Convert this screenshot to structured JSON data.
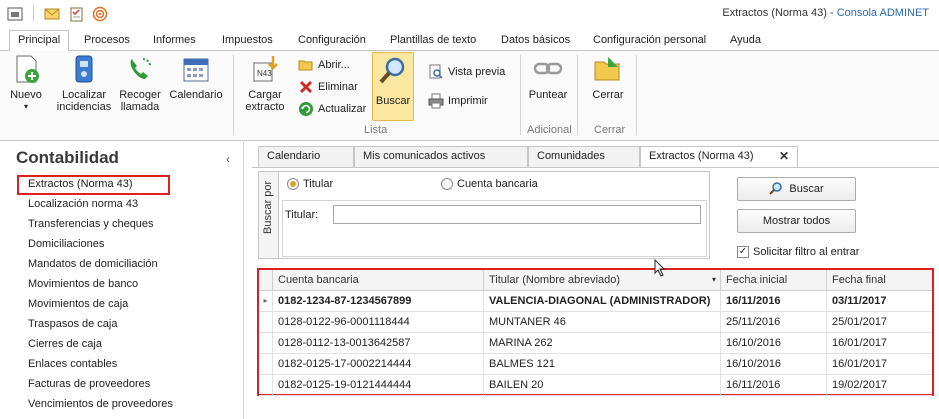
{
  "window": {
    "title": "Extractos (Norma 43)",
    "separator": " - ",
    "app": "Consola ADMINET"
  },
  "qat": {
    "icons": [
      "app-menu-icon",
      "mail-icon",
      "checklist-icon",
      "rss-icon"
    ]
  },
  "ribbon_tabs": [
    "Principal",
    "Procesos",
    "Informes",
    "Impuestos",
    "Configuración",
    "Plantillas de texto",
    "Datos básicos",
    "Configuración personal",
    "Ayuda"
  ],
  "ribbon": {
    "nuevo": "Nuevo",
    "nuevo_arrow": "▾",
    "localizar": [
      "Localizar",
      "incidencias"
    ],
    "recoger": [
      "Recoger",
      "llamada"
    ],
    "calendario": "Calendario",
    "cargar": [
      "Cargar",
      "extracto"
    ],
    "abrir": "Abrir...",
    "eliminar": "Eliminar",
    "actualizar": "Actualizar",
    "buscar": "Buscar",
    "vista_previa": "Vista previa",
    "imprimir": "Imprimir",
    "puntear": "Puntear",
    "cerrar": "Cerrar",
    "groups": {
      "lista": "Lista",
      "adicional": "Adicional",
      "cerrar": "Cerrar"
    }
  },
  "sidebar": {
    "title": "Contabilidad",
    "collapse": "‹",
    "items": [
      "Extractos (Norma 43)",
      "Localización norma 43",
      "Transferencias y cheques",
      "Domiciliaciones",
      "Mandatos de domiciliación",
      "Movimientos de banco",
      "Movimientos de caja",
      "Traspasos de caja",
      "Cierres de caja",
      "Enlaces contables",
      "Facturas de proveedores",
      "Vencimientos de proveedores"
    ]
  },
  "doc_tabs": [
    "Calendario",
    "Mis comunicados activos",
    "Comunidades",
    "Extractos (Norma 43)"
  ],
  "doc_tab_close": "✕",
  "search": {
    "group_label": "Buscar por",
    "radio_titular": "Titular",
    "radio_cuenta": "Cuenta bancaria",
    "titular_label": "Titular:",
    "titular_value": "",
    "btn_buscar": "Buscar",
    "btn_mostrar": "Mostrar todos",
    "chk_solicitar": "Solicitar filtro al entrar",
    "chk_mark": "✓"
  },
  "grid": {
    "columns": [
      "Cuenta bancaria",
      "Titular (Nombre abreviado)",
      "Fecha inicial",
      "Fecha final"
    ],
    "sort_indicator": "▾",
    "current_row_marker": "▸",
    "rows": [
      [
        "0182-1234-87-1234567899",
        "VALENCIA-DIAGONAL (ADMINISTRADOR)",
        "16/11/2016",
        "03/11/2017"
      ],
      [
        "0128-0122-96-0001118444",
        "MUNTANER 46",
        "25/11/2016",
        "25/01/2017"
      ],
      [
        "0128-0112-13-0013642587",
        "MARINA 262",
        "16/10/2016",
        "16/01/2017"
      ],
      [
        "0182-0125-17-0002214444",
        "BALMES 121",
        "16/10/2016",
        "16/01/2017"
      ],
      [
        "0182-0125-19-0121444444",
        "BAILEN 20",
        "16/11/2016",
        "19/02/2017"
      ]
    ]
  },
  "colors": {
    "highlight_red": "#e02020",
    "active_button": "#fbe7a0",
    "app_title_blue": "#2b6cb0"
  }
}
